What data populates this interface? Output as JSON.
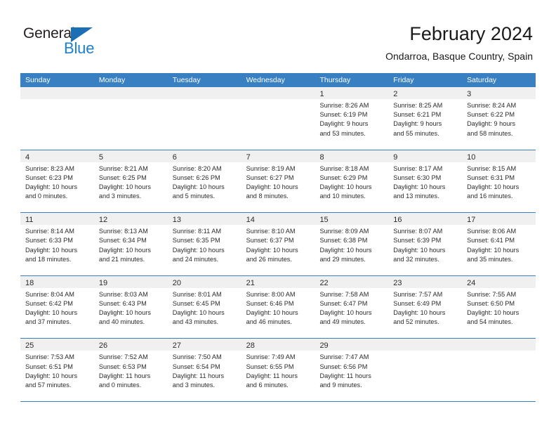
{
  "brand": {
    "name_top": "General",
    "name_bottom": "Blue",
    "accent_color": "#1b7fd4",
    "triangle_color": "#1b6fb5"
  },
  "header": {
    "title": "February 2024",
    "subtitle": "Ondarroa, Basque Country, Spain"
  },
  "calendar": {
    "header_bg": "#3880c2",
    "day_strip_bg": "#f0f0f0",
    "weekday_headers": [
      "Sunday",
      "Monday",
      "Tuesday",
      "Wednesday",
      "Thursday",
      "Friday",
      "Saturday"
    ],
    "weeks": [
      [
        {
          "day": "",
          "lines": []
        },
        {
          "day": "",
          "lines": []
        },
        {
          "day": "",
          "lines": []
        },
        {
          "day": "",
          "lines": []
        },
        {
          "day": "1",
          "lines": [
            "Sunrise: 8:26 AM",
            "Sunset: 6:19 PM",
            "Daylight: 9 hours",
            "and 53 minutes."
          ]
        },
        {
          "day": "2",
          "lines": [
            "Sunrise: 8:25 AM",
            "Sunset: 6:21 PM",
            "Daylight: 9 hours",
            "and 55 minutes."
          ]
        },
        {
          "day": "3",
          "lines": [
            "Sunrise: 8:24 AM",
            "Sunset: 6:22 PM",
            "Daylight: 9 hours",
            "and 58 minutes."
          ]
        }
      ],
      [
        {
          "day": "4",
          "lines": [
            "Sunrise: 8:23 AM",
            "Sunset: 6:23 PM",
            "Daylight: 10 hours",
            "and 0 minutes."
          ]
        },
        {
          "day": "5",
          "lines": [
            "Sunrise: 8:21 AM",
            "Sunset: 6:25 PM",
            "Daylight: 10 hours",
            "and 3 minutes."
          ]
        },
        {
          "day": "6",
          "lines": [
            "Sunrise: 8:20 AM",
            "Sunset: 6:26 PM",
            "Daylight: 10 hours",
            "and 5 minutes."
          ]
        },
        {
          "day": "7",
          "lines": [
            "Sunrise: 8:19 AM",
            "Sunset: 6:27 PM",
            "Daylight: 10 hours",
            "and 8 minutes."
          ]
        },
        {
          "day": "8",
          "lines": [
            "Sunrise: 8:18 AM",
            "Sunset: 6:29 PM",
            "Daylight: 10 hours",
            "and 10 minutes."
          ]
        },
        {
          "day": "9",
          "lines": [
            "Sunrise: 8:17 AM",
            "Sunset: 6:30 PM",
            "Daylight: 10 hours",
            "and 13 minutes."
          ]
        },
        {
          "day": "10",
          "lines": [
            "Sunrise: 8:15 AM",
            "Sunset: 6:31 PM",
            "Daylight: 10 hours",
            "and 16 minutes."
          ]
        }
      ],
      [
        {
          "day": "11",
          "lines": [
            "Sunrise: 8:14 AM",
            "Sunset: 6:33 PM",
            "Daylight: 10 hours",
            "and 18 minutes."
          ]
        },
        {
          "day": "12",
          "lines": [
            "Sunrise: 8:13 AM",
            "Sunset: 6:34 PM",
            "Daylight: 10 hours",
            "and 21 minutes."
          ]
        },
        {
          "day": "13",
          "lines": [
            "Sunrise: 8:11 AM",
            "Sunset: 6:35 PM",
            "Daylight: 10 hours",
            "and 24 minutes."
          ]
        },
        {
          "day": "14",
          "lines": [
            "Sunrise: 8:10 AM",
            "Sunset: 6:37 PM",
            "Daylight: 10 hours",
            "and 26 minutes."
          ]
        },
        {
          "day": "15",
          "lines": [
            "Sunrise: 8:09 AM",
            "Sunset: 6:38 PM",
            "Daylight: 10 hours",
            "and 29 minutes."
          ]
        },
        {
          "day": "16",
          "lines": [
            "Sunrise: 8:07 AM",
            "Sunset: 6:39 PM",
            "Daylight: 10 hours",
            "and 32 minutes."
          ]
        },
        {
          "day": "17",
          "lines": [
            "Sunrise: 8:06 AM",
            "Sunset: 6:41 PM",
            "Daylight: 10 hours",
            "and 35 minutes."
          ]
        }
      ],
      [
        {
          "day": "18",
          "lines": [
            "Sunrise: 8:04 AM",
            "Sunset: 6:42 PM",
            "Daylight: 10 hours",
            "and 37 minutes."
          ]
        },
        {
          "day": "19",
          "lines": [
            "Sunrise: 8:03 AM",
            "Sunset: 6:43 PM",
            "Daylight: 10 hours",
            "and 40 minutes."
          ]
        },
        {
          "day": "20",
          "lines": [
            "Sunrise: 8:01 AM",
            "Sunset: 6:45 PM",
            "Daylight: 10 hours",
            "and 43 minutes."
          ]
        },
        {
          "day": "21",
          "lines": [
            "Sunrise: 8:00 AM",
            "Sunset: 6:46 PM",
            "Daylight: 10 hours",
            "and 46 minutes."
          ]
        },
        {
          "day": "22",
          "lines": [
            "Sunrise: 7:58 AM",
            "Sunset: 6:47 PM",
            "Daylight: 10 hours",
            "and 49 minutes."
          ]
        },
        {
          "day": "23",
          "lines": [
            "Sunrise: 7:57 AM",
            "Sunset: 6:49 PM",
            "Daylight: 10 hours",
            "and 52 minutes."
          ]
        },
        {
          "day": "24",
          "lines": [
            "Sunrise: 7:55 AM",
            "Sunset: 6:50 PM",
            "Daylight: 10 hours",
            "and 54 minutes."
          ]
        }
      ],
      [
        {
          "day": "25",
          "lines": [
            "Sunrise: 7:53 AM",
            "Sunset: 6:51 PM",
            "Daylight: 10 hours",
            "and 57 minutes."
          ]
        },
        {
          "day": "26",
          "lines": [
            "Sunrise: 7:52 AM",
            "Sunset: 6:53 PM",
            "Daylight: 11 hours",
            "and 0 minutes."
          ]
        },
        {
          "day": "27",
          "lines": [
            "Sunrise: 7:50 AM",
            "Sunset: 6:54 PM",
            "Daylight: 11 hours",
            "and 3 minutes."
          ]
        },
        {
          "day": "28",
          "lines": [
            "Sunrise: 7:49 AM",
            "Sunset: 6:55 PM",
            "Daylight: 11 hours",
            "and 6 minutes."
          ]
        },
        {
          "day": "29",
          "lines": [
            "Sunrise: 7:47 AM",
            "Sunset: 6:56 PM",
            "Daylight: 11 hours",
            "and 9 minutes."
          ]
        },
        {
          "day": "",
          "lines": []
        },
        {
          "day": "",
          "lines": []
        }
      ]
    ]
  }
}
